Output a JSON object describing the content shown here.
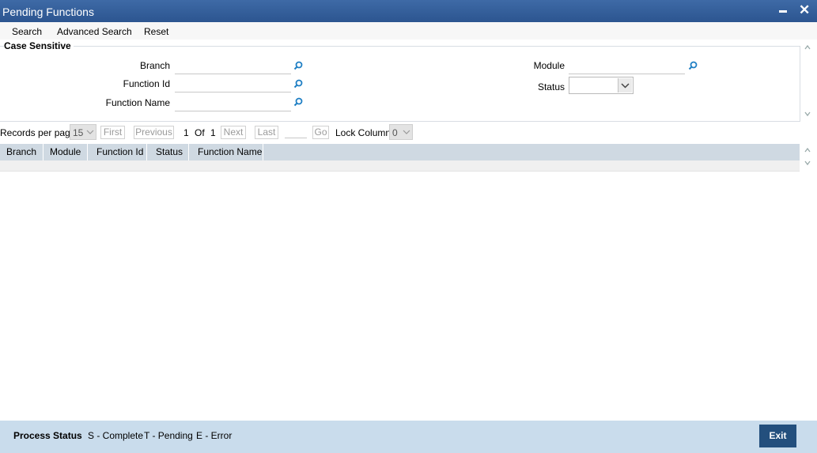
{
  "window": {
    "title": "Pending Functions",
    "minimize_glyph": "",
    "close_glyph": "✕"
  },
  "toolbar": {
    "search": "Search",
    "advanced_search": "Advanced Search",
    "reset": "Reset"
  },
  "criteria": {
    "legend": "Case Sensitive",
    "branch": {
      "label": "Branch",
      "value": ""
    },
    "function_id": {
      "label": "Function Id",
      "value": ""
    },
    "function_name": {
      "label": "Function Name",
      "value": ""
    },
    "module": {
      "label": "Module",
      "value": ""
    },
    "status": {
      "label": "Status",
      "value": ""
    }
  },
  "pager": {
    "records_per_page_label": "Records per page",
    "records_per_page": "15",
    "first": "First",
    "previous": "Previous",
    "current_page": "1",
    "of_label": "Of",
    "total_pages": "1",
    "next": "Next",
    "last": "Last",
    "go": "Go",
    "lock_columns_label": "Lock Columns",
    "lock_columns": "0"
  },
  "grid": {
    "columns": [
      "Branch",
      "Module",
      "Function Id",
      "Status",
      "Function Name"
    ]
  },
  "footer": {
    "process_status_label": "Process Status",
    "legend_complete": "S - Complete",
    "legend_pending": "T - Pending",
    "legend_error": "E - Error",
    "exit": "Exit"
  },
  "icons": {
    "lookup": "search-icon",
    "dropdown": "chevron-down-icon"
  },
  "colors": {
    "titlebar": "#2c5590",
    "footer": "#c9dcec",
    "exit_button": "#234f7d",
    "lookup_icon": "#1f7fc4"
  }
}
